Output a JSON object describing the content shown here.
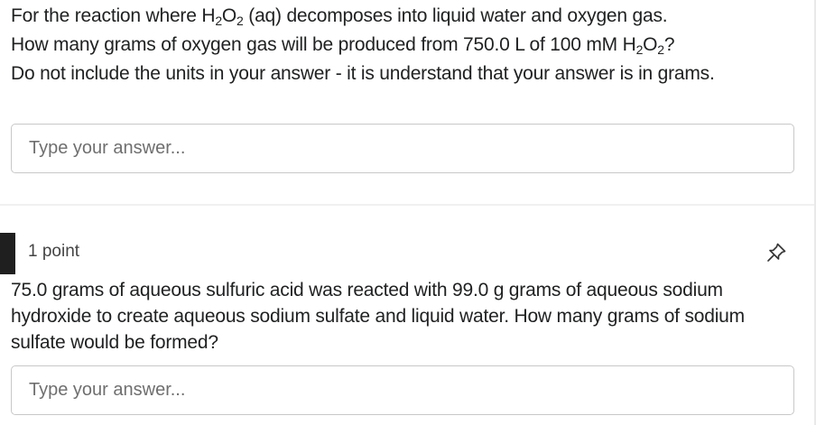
{
  "question1": {
    "line1_pre": "For the reaction where H",
    "line1_sub1": "2",
    "line1_mid": "O",
    "line1_sub2": "2",
    "line1_post": " (aq) decomposes into liquid water and oxygen gas.",
    "line2_pre": "How many grams of oxygen gas will be produced from 750.0 L of 100 mM H",
    "line2_sub1": "2",
    "line2_mid": "O",
    "line2_sub2": "2",
    "line2_post": "?",
    "line3": "Do not include the units in your answer - it is understand that your answer is in grams.",
    "answer_placeholder": "Type your answer...",
    "answer_value": ""
  },
  "question2": {
    "points": "1 point",
    "text": "75.0 grams of aqueous sulfuric acid was reacted with 99.0 g grams of aqueous sodium hydroxide to create aqueous sodium sulfate and liquid water. How many grams of sodium sulfate would be formed?",
    "answer_placeholder": "Type your answer...",
    "answer_value": ""
  },
  "icons": {
    "pin": "pin-icon"
  },
  "colors": {
    "accent_bar": "#1f1f1f",
    "border": "#c8c8c8",
    "placeholder": "#6f6f6f",
    "text": "#202122"
  }
}
